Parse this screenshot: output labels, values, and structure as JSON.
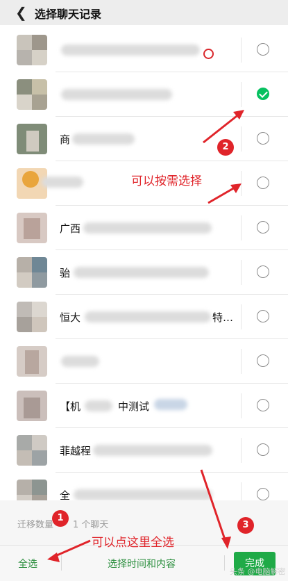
{
  "header": {
    "title": "选择聊天记录",
    "back_icon": "chevron-left-icon"
  },
  "chats": [
    {
      "name": "",
      "selected": false
    },
    {
      "name": "",
      "selected": true
    },
    {
      "name": "商",
      "selected": false
    },
    {
      "name": "",
      "selected": false
    },
    {
      "name": "广西",
      "selected": false
    },
    {
      "name": "骀",
      "selected": false
    },
    {
      "name": "恒大",
      "tail": "特…",
      "selected": false
    },
    {
      "name": "",
      "selected": false
    },
    {
      "name": "【机",
      "tail": "中测试",
      "selected": false
    },
    {
      "name": "菲越程",
      "selected": false
    },
    {
      "name": "全",
      "selected": false
    }
  ],
  "migrate": {
    "label": "迁移数量",
    "count": "1 个聊天"
  },
  "bottom": {
    "select_all": "全选",
    "select_time": "选择时间和内容",
    "done": "完成"
  },
  "annotations": {
    "note_select": "可以按需选择",
    "note_select_all": "可以点这里全选",
    "badge1": "1",
    "badge2": "2",
    "badge3": "3"
  },
  "watermark": "头条 @电脑解密",
  "colors": {
    "accent_green": "#07c160",
    "button_green": "#1faa47",
    "annotation_red": "#e0242a"
  }
}
